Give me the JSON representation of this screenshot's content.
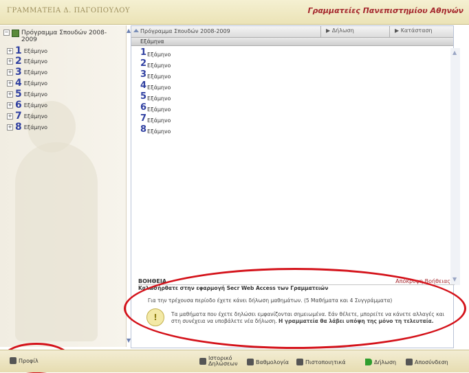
{
  "header": {
    "left_brand": "ΓΡΑΜΜΑΤΕΙΑ Δ. ΠΑΓΟΠΟΥΛΟΥ",
    "right_title": "Γραμματείες Πανεπιστημίου Αθηνών"
  },
  "sidebar": {
    "root_label": "Πρόγραμμα Σπουδών 2008-2009",
    "items": [
      {
        "num": "1",
        "label": "Εξάμηνο"
      },
      {
        "num": "2",
        "label": "Εξάμηνο"
      },
      {
        "num": "3",
        "label": "Εξάμηνο"
      },
      {
        "num": "4",
        "label": "Εξάμηνο"
      },
      {
        "num": "5",
        "label": "Εξάμηνο"
      },
      {
        "num": "6",
        "label": "Εξάμηνο"
      },
      {
        "num": "7",
        "label": "Εξάμηνο"
      },
      {
        "num": "8",
        "label": "Εξάμηνο"
      }
    ]
  },
  "main": {
    "title": "Πρόγραμμα Σπουδών 2008-2009",
    "tabs": [
      {
        "label": "Δήλωση"
      },
      {
        "label": "Κατάσταση"
      }
    ],
    "column_header": "Εξάμηνα",
    "items": [
      {
        "num": "1",
        "label": "Εξάμηνο"
      },
      {
        "num": "2",
        "label": "Εξάμηνο"
      },
      {
        "num": "3",
        "label": "Εξάμηνο"
      },
      {
        "num": "4",
        "label": "Εξάμηνο"
      },
      {
        "num": "5",
        "label": "Εξάμηνο"
      },
      {
        "num": "6",
        "label": "Εξάμηνο"
      },
      {
        "num": "7",
        "label": "Εξάμηνο"
      },
      {
        "num": "8",
        "label": "Εξάμηνο"
      }
    ]
  },
  "help": {
    "title": "ΒΟΗΘΕΙΑ",
    "hide_link": "Απόκρυψη Βοήθειας",
    "welcome": "Καλωσήρθατε στην εφαρμογή Secr Web Access των Γραμματειών",
    "line1": "Για την τρέχουσα περίοδο έχετε κάνει δήλωση μαθημάτων. (5 Μαθήματα και 4 Συγγράμματα)",
    "line2_plain": "Τα μαθήματα που έχετε δηλώσει εμφανίζονται σημειωμένα. Εάν θέλετε, μπορείτε να κάνετε αλλαγές και στη συνέχεια να υποβάλετε νέα δήλωση.",
    "line2_bold": "Η γραμματεία θα λάβει υπόψη της μόνο τη τελευταία."
  },
  "footer": {
    "profile": "Προφίλ",
    "buttons": [
      {
        "label": "Ιστορικό Δηλώσεων"
      },
      {
        "label": "Βαθμολογία"
      },
      {
        "label": "Πιστοποιητικά"
      },
      {
        "label": "Δήλωση"
      },
      {
        "label": "Αποσύνδεση"
      }
    ]
  },
  "colors": {
    "accent_red": "#a4262c",
    "semester_blue": "#2f3fa0",
    "annotation_red": "#d4121a"
  }
}
